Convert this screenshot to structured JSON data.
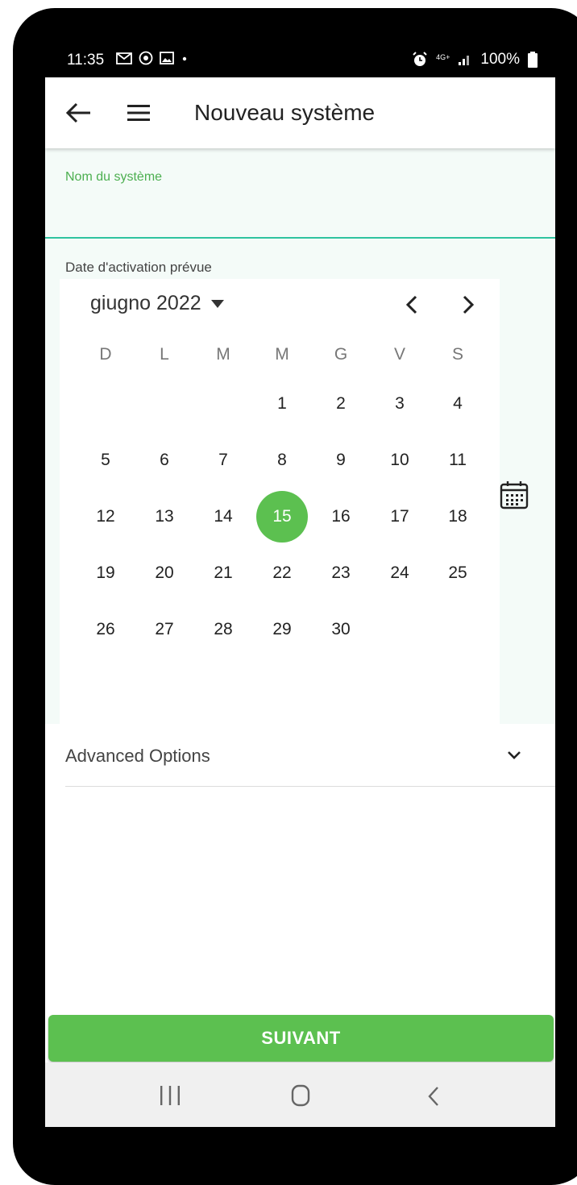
{
  "status_bar": {
    "time": "11:35",
    "battery": "100%",
    "network": "4G+"
  },
  "app_bar": {
    "title": "Nouveau système"
  },
  "name_field": {
    "label": "Nom du système",
    "value": ""
  },
  "date_picker": {
    "label": "Date d'activation prévue",
    "month_label": "giugno 2022",
    "weekdays": [
      "D",
      "L",
      "M",
      "M",
      "G",
      "V",
      "S"
    ],
    "weeks": [
      [
        "",
        "",
        "",
        "1",
        "2",
        "3",
        "4"
      ],
      [
        "5",
        "6",
        "7",
        "8",
        "9",
        "10",
        "11"
      ],
      [
        "12",
        "13",
        "14",
        "15",
        "16",
        "17",
        "18"
      ],
      [
        "19",
        "20",
        "21",
        "22",
        "23",
        "24",
        "25"
      ],
      [
        "26",
        "27",
        "28",
        "29",
        "30",
        "",
        ""
      ]
    ],
    "selected_day": "15"
  },
  "advanced": {
    "label": "Advanced Options"
  },
  "footer": {
    "next_label": "SUIVANT"
  },
  "colors": {
    "accent_green": "#5cc050",
    "field_underline": "#2fc3a0",
    "label_green": "#4caf50"
  }
}
